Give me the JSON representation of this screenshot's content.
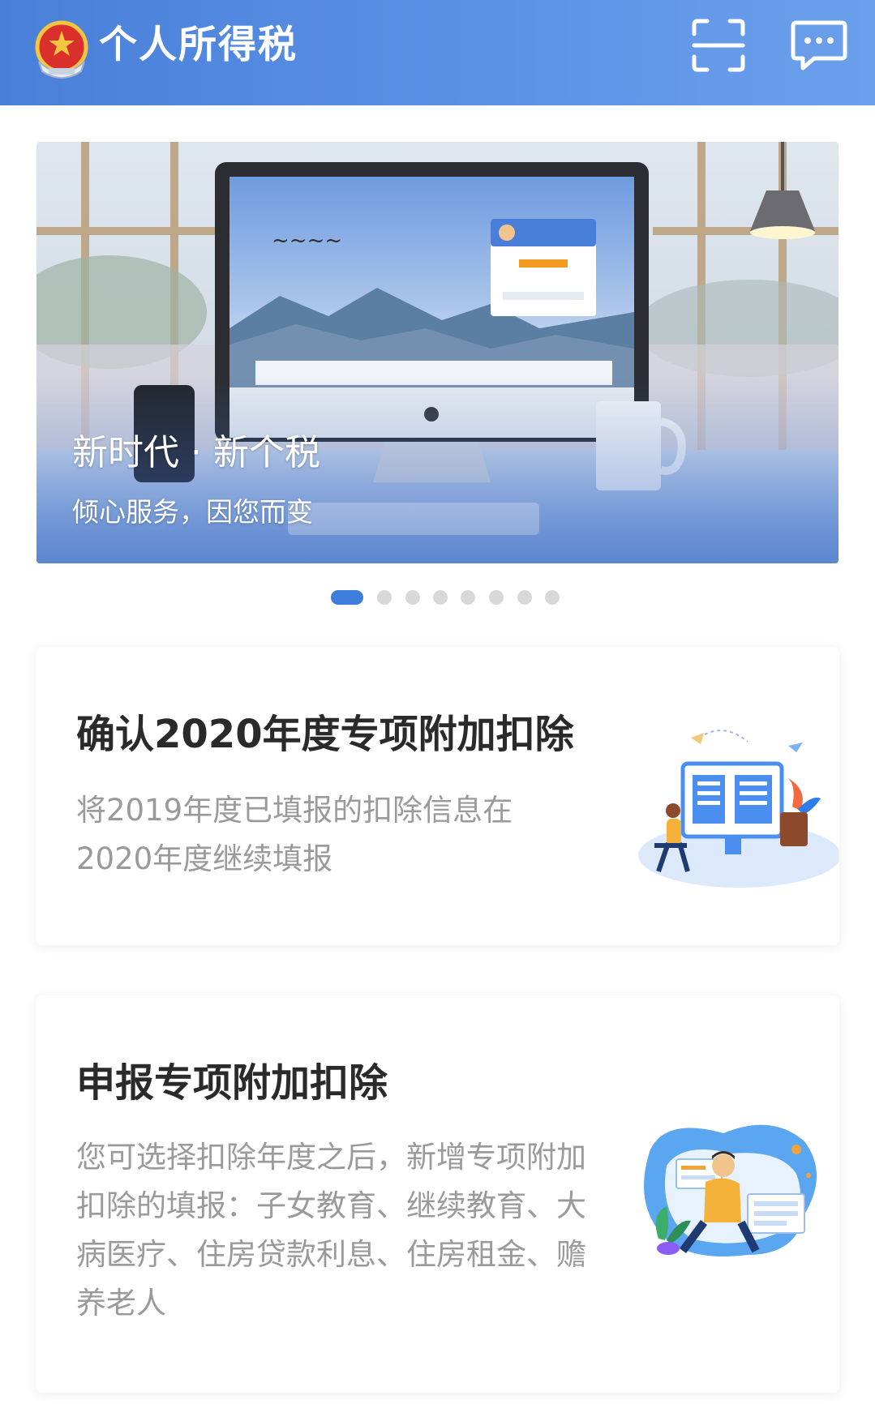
{
  "header": {
    "title": "个人所得税",
    "emblem_icon": "national-emblem-icon",
    "scan_icon": "scan-icon",
    "message_icon": "message-icon",
    "background_color": "#4a7fd9"
  },
  "banner": {
    "title": "新时代 · 新个税",
    "subtitle": "倾心服务，因您而变",
    "pager": {
      "total": 8,
      "active_index": 0,
      "active_color": "#3f7fdc",
      "inactive_color": "#d8d8d8"
    }
  },
  "cards": [
    {
      "title": "确认2020年度专项附加扣除",
      "description": "将2019年度已填报的扣除信息在2020年度继续填报",
      "illustration_icon": "person-at-computer-illustration"
    },
    {
      "title": "申报专项附加扣除",
      "description": "您可选择扣除年度之后，新增专项附加扣除的填报：子女教育、继续教育、大病医疗、住房贷款利息、住房租金、赡养老人",
      "illustration_icon": "person-filling-form-illustration"
    }
  ]
}
